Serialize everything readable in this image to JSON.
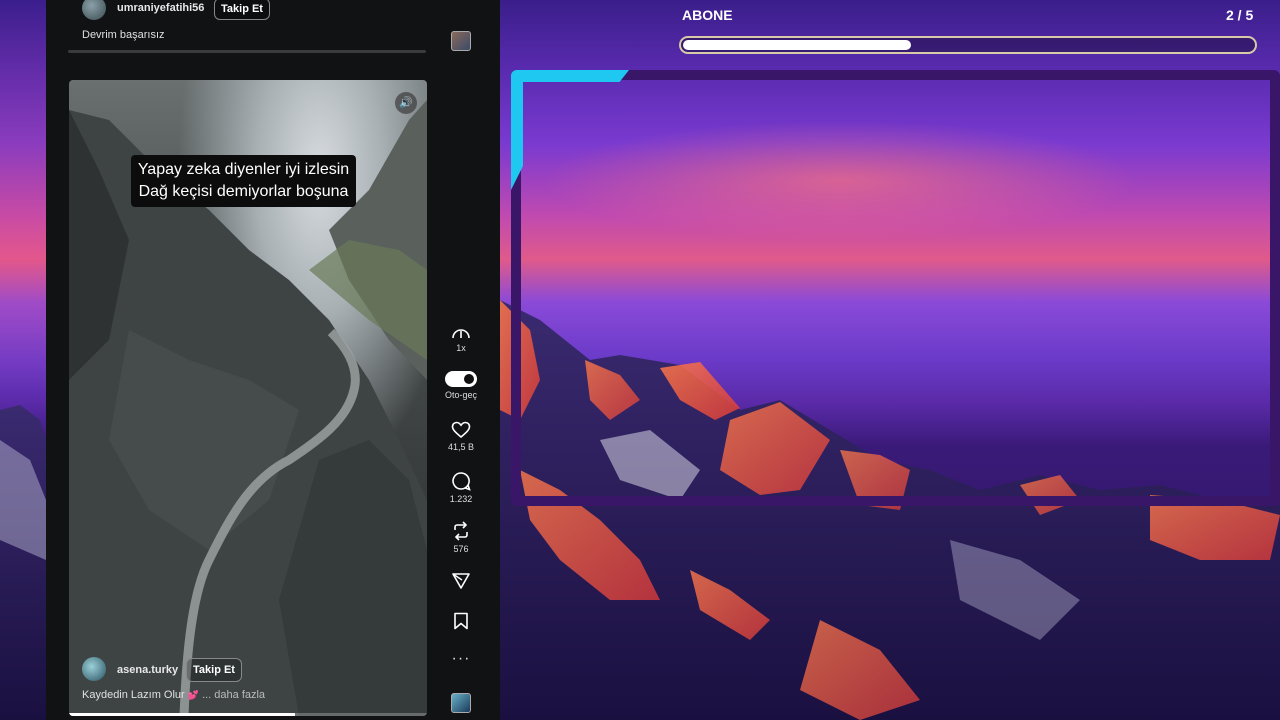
{
  "colors": {
    "feed_bg": "#111214",
    "frame_purple": "#3a1668",
    "frame_cyan": "#1ec8f0",
    "progress_border": "#d8c9a8"
  },
  "previous_post": {
    "username": "umraniyefatihi56",
    "follow_label": "Takip Et",
    "caption": "Devrim başarısız"
  },
  "video": {
    "overlay_line1": "Yapay zeka diyenler iyi izlesin",
    "overlay_line2": "Dağ keçisi demiyorlar boşuna",
    "mute_icon": "speaker-icon",
    "progress": 0.63,
    "author": {
      "username": "asena.turky",
      "follow_label": "Takip Et"
    },
    "caption": "Kaydedin Lazım Olur",
    "caption_emoji": "💕",
    "more_label": "... daha fazla"
  },
  "rail": {
    "more_top": "···",
    "speed_label": "1x",
    "autoplay_label": "Oto-geç",
    "likes": "41,5 B",
    "comments": "1.232",
    "reposts": "576",
    "more_bottom": "···"
  },
  "subscription": {
    "label": "ABONE",
    "count": "2 / 5",
    "progress": 0.4
  }
}
